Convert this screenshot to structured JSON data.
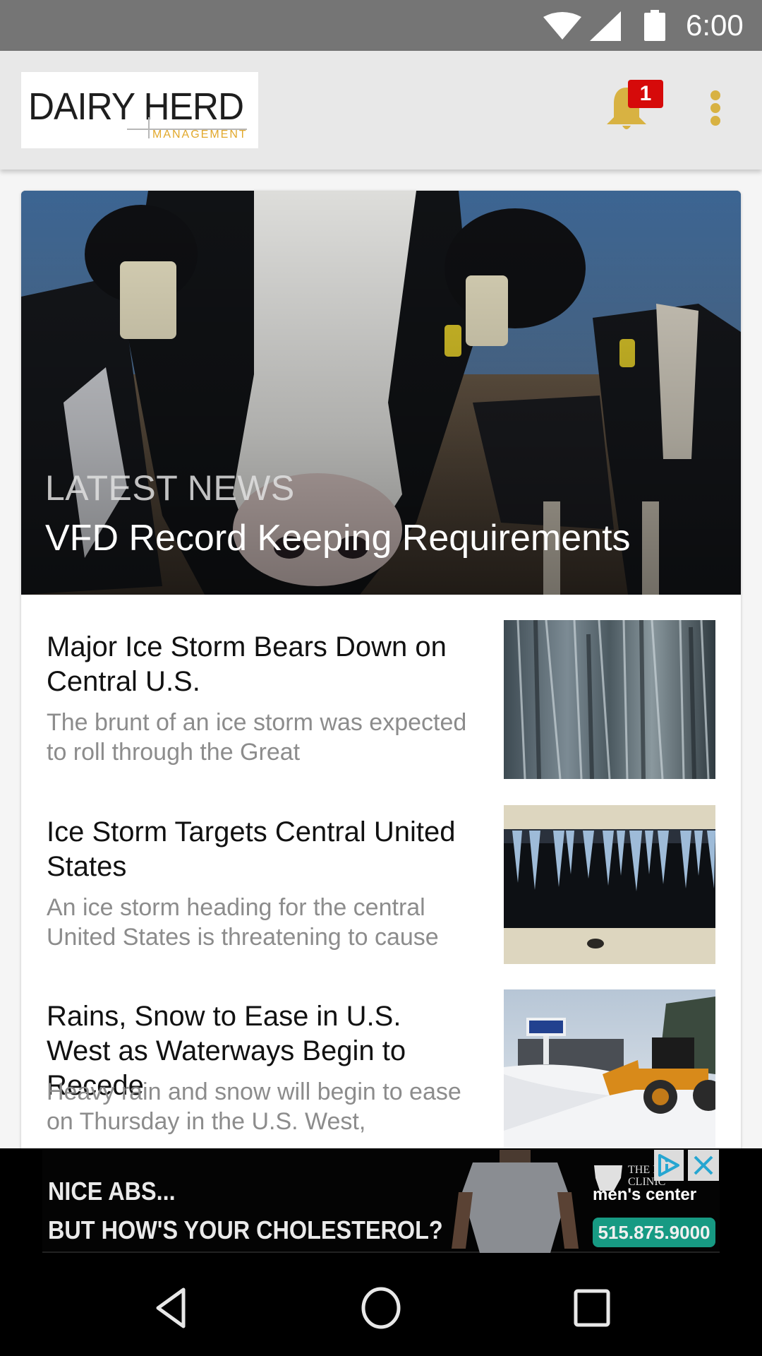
{
  "status_bar": {
    "time": "6:00",
    "icons": [
      "wifi-icon",
      "cellular-signal-icon",
      "battery-icon"
    ]
  },
  "app_bar": {
    "logo": {
      "primary": "DAIRY HERD",
      "secondary": "MANAGEMENT"
    },
    "notifications": {
      "icon": "bell-icon",
      "badge_count": "1"
    },
    "menu_icon": "overflow-menu-icon",
    "accent_color": "#d8b242",
    "badge_color": "#d60a0a"
  },
  "featured": {
    "kicker": "LATEST NEWS",
    "headline": "VFD Record Keeping Requirements",
    "image": "dairy-cows-photo"
  },
  "articles": [
    {
      "title": "Major Ice Storm Bears Down on Central U.S.",
      "summary": "The brunt of an ice storm was expected to roll through the Great",
      "image": "icicles-closeup-photo"
    },
    {
      "title": "Ice Storm Targets Central United States",
      "summary": "An ice storm heading for the central United States is threatening to cause",
      "image": "icicles-on-fence-photo"
    },
    {
      "title": "Rains, Snow to Ease in U.S. West as Waterways Begin to Recede",
      "summary": "Heavy rain and snow will begin to ease on Thursday in the U.S. West,",
      "image": "snow-plow-photo"
    }
  ],
  "ad": {
    "line1": "NICE ABS...",
    "line2": "BUT HOW'S YOUR CHOLESTEROL?",
    "clinic_name": "THE IOWA CLINIC",
    "clinic_sub": "men's center",
    "phone": "515.875.9000",
    "phone_color": "#179a83",
    "adchoices_icon": "adchoices-icon",
    "close_icon": "close-icon"
  },
  "nav_bar": {
    "buttons": [
      "back",
      "home",
      "recents"
    ]
  }
}
